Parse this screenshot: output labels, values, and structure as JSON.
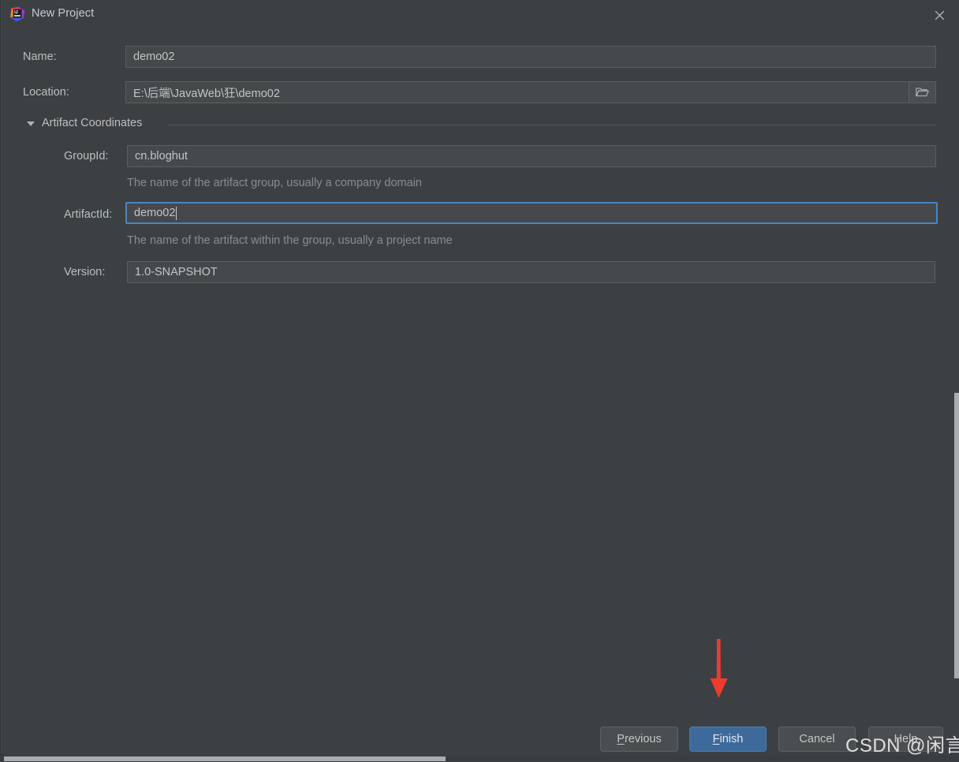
{
  "window": {
    "title": "New Project",
    "app_icon": "intellij-idea-icon",
    "close_icon": "close-icon"
  },
  "form": {
    "name": {
      "label": "Name:",
      "value": "demo02",
      "placeholder": ""
    },
    "location": {
      "label": "Location:",
      "value": "E:\\后端\\JavaWeb\\狂\\demo02",
      "placeholder": "",
      "browse_icon": "folder-icon"
    }
  },
  "artifact_section": {
    "title": "Artifact Coordinates",
    "expanded": true,
    "collapse_icon": "triangle-down-icon",
    "fields": {
      "group_id": {
        "label": "GroupId:",
        "value": "cn.bloghut",
        "hint": "The name of the artifact group, usually a company domain"
      },
      "artifact_id": {
        "label": "ArtifactId:",
        "value": "demo02",
        "hint": "The name of the artifact within the group, usually a project name",
        "focused": true
      },
      "version": {
        "label": "Version:",
        "value": "1.0-SNAPSHOT",
        "hint": ""
      }
    }
  },
  "buttons": {
    "previous": {
      "label": "Previous",
      "mnemonic": "P"
    },
    "finish": {
      "label": "Finish",
      "mnemonic": "F",
      "primary": true
    },
    "cancel": {
      "label": "Cancel",
      "mnemonic": ""
    },
    "help": {
      "label": "Help",
      "mnemonic": ""
    }
  },
  "annotation": {
    "arrow_icon": "red-down-arrow-icon",
    "arrow_color": "#ef3b2d"
  },
  "watermark": {
    "text": "CSDN @闲言_"
  },
  "colors": {
    "dialog_background": "#3c4043",
    "field_background": "#45494b",
    "field_border": "#5a5f61",
    "focus_border": "#4b84c4",
    "primary_button": "#3d6a9b",
    "text": "#bdbfc0",
    "hint_text": "#8a8d8f"
  }
}
